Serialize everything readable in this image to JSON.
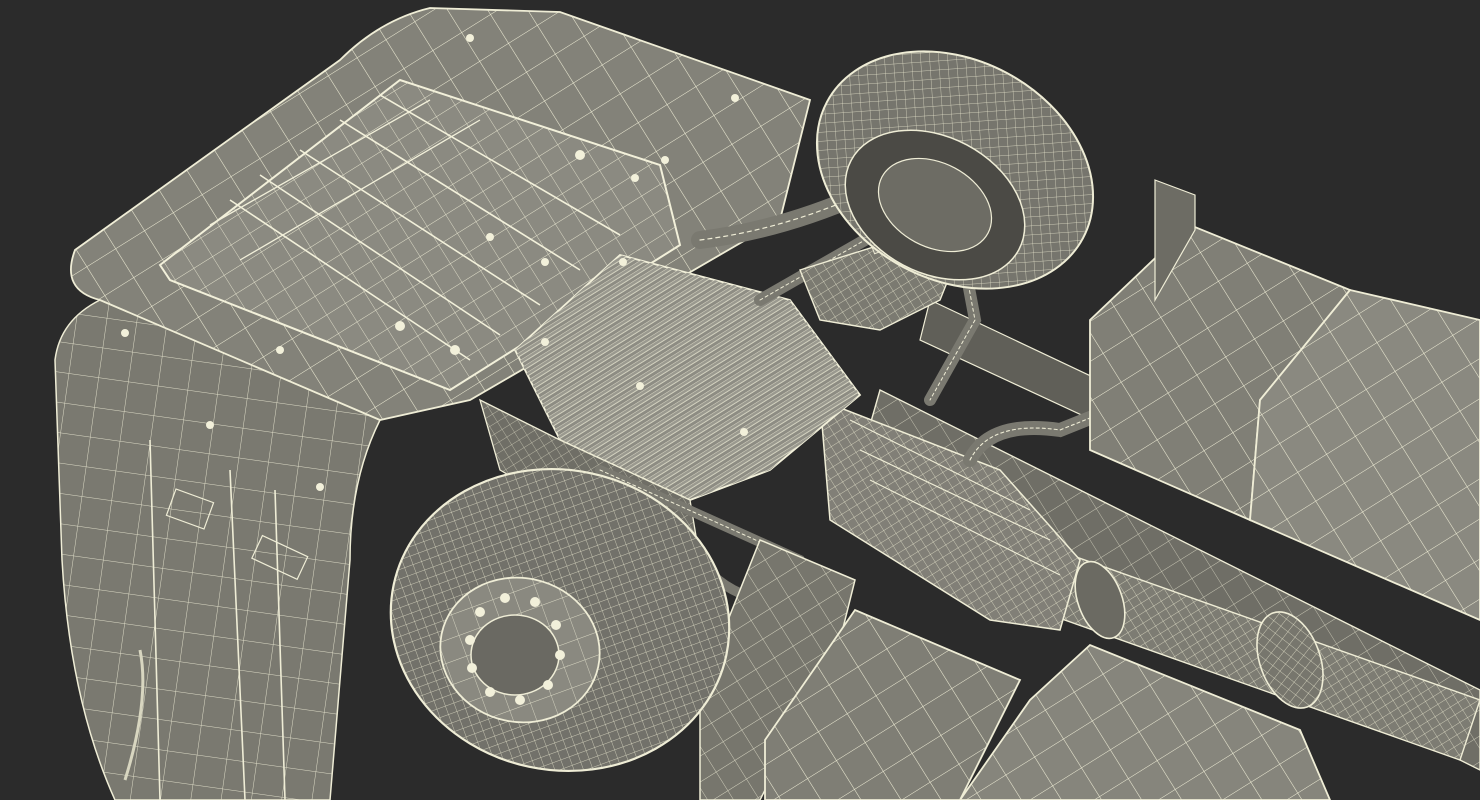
{
  "scene": {
    "subject": "wireframe-truck-underside",
    "colors": {
      "background": "#2b2b2b",
      "body_fill": "#7e7d74",
      "body_light": "#8e8d84",
      "body_dark": "#5f5e57",
      "shadow": "#3f3e39",
      "wire": "#efedd6",
      "wire_dim": "#d8d6c0",
      "tire": "#6e6d66",
      "tire_dark": "#4f4e49"
    }
  }
}
